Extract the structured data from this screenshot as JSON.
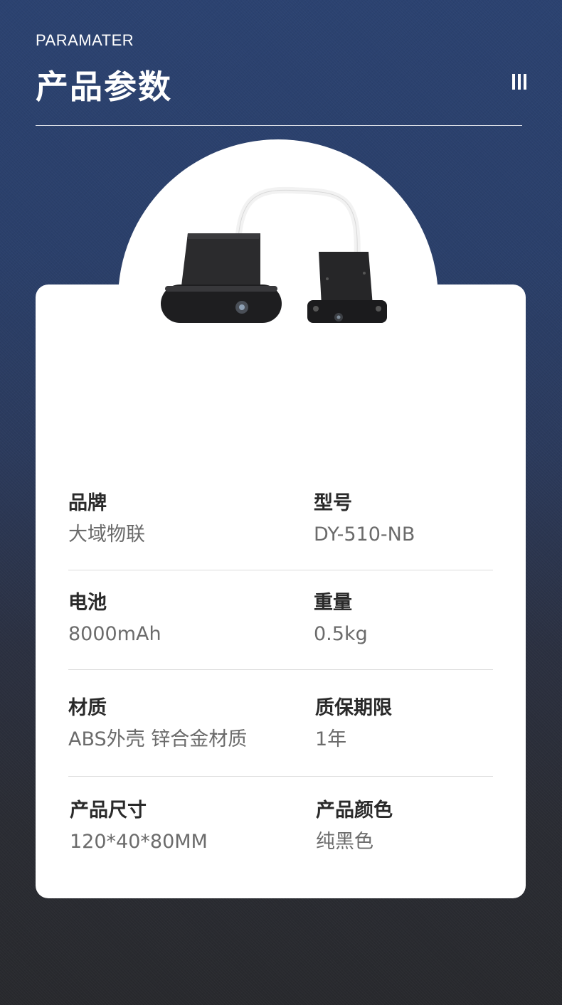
{
  "header": {
    "eyebrow": "PARAMATER",
    "title": "产品参数"
  },
  "specs": [
    {
      "label": "品牌",
      "value": "大域物联"
    },
    {
      "label": "型号",
      "value": "DY-510-NB"
    },
    {
      "label": "电池",
      "value": "8000mAh"
    },
    {
      "label": "重量",
      "value": "0.5kg"
    },
    {
      "label": "材质",
      "value": "ABS外壳 锌合金材质"
    },
    {
      "label": "质保期限",
      "value": "1年"
    },
    {
      "label": "产品尺寸",
      "value": "120*40*80MM"
    },
    {
      "label": "产品颜色",
      "value": "纯黑色"
    }
  ],
  "colors": {
    "background_top": "#2b4270",
    "background_bottom": "#28292d",
    "card": "#ffffff",
    "label": "#2a2a2a",
    "value": "#6b6b6b"
  },
  "icons": [
    "menu-bars-icon"
  ]
}
